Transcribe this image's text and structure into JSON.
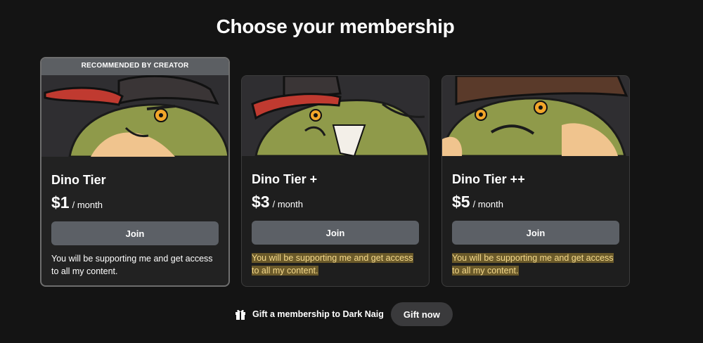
{
  "page": {
    "title": "Choose your membership"
  },
  "tiers": [
    {
      "badge": "RECOMMENDED BY CREATOR",
      "name": "Dino Tier",
      "price": "$1",
      "period": "/ month",
      "join_label": "Join",
      "description": "You will be supporting me and get access to all my content."
    },
    {
      "name": "Dino Tier +",
      "price": "$3",
      "period": "/ month",
      "join_label": "Join",
      "description": "You will be supporting me and get access to all my content."
    },
    {
      "name": "Dino Tier ++",
      "price": "$5",
      "period": "/ month",
      "join_label": "Join",
      "description": "You will be supporting me and get access to all my content."
    }
  ],
  "gift": {
    "icon": "gift-icon",
    "text": "Gift a membership to Dark Naig",
    "button_label": "Gift now"
  },
  "colors": {
    "background": "#141414",
    "card": "#1e1e1e",
    "button": "#5c6066",
    "highlight_bg": "#6b5a2a",
    "highlight_text": "#f5d98a"
  }
}
